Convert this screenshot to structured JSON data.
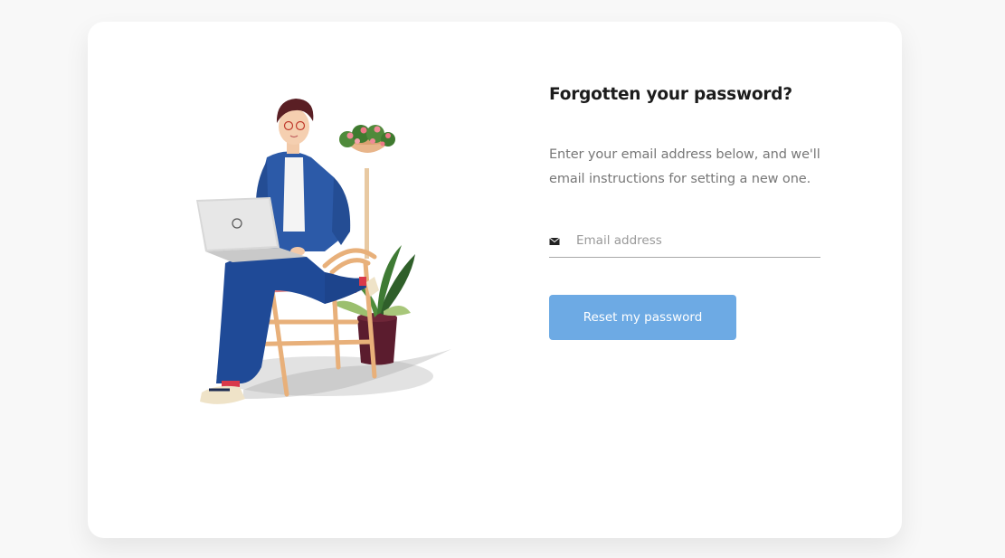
{
  "form": {
    "title": "Forgotten your password?",
    "description": "Enter your email address below, and we'll email instructions for setting a new one.",
    "email_placeholder": "Email address",
    "email_value": "",
    "email_icon": "envelope-icon",
    "submit_label": "Reset my password"
  },
  "illustration": {
    "subject": "person-with-laptop-on-chair"
  },
  "colors": {
    "page_background": "#f8f8f8",
    "card_background": "#ffffff",
    "title": "#1c1c1c",
    "body_text": "#777777",
    "button_background": "#6daae4",
    "button_text": "#ffffff",
    "input_underline": "#a9a9a9"
  }
}
